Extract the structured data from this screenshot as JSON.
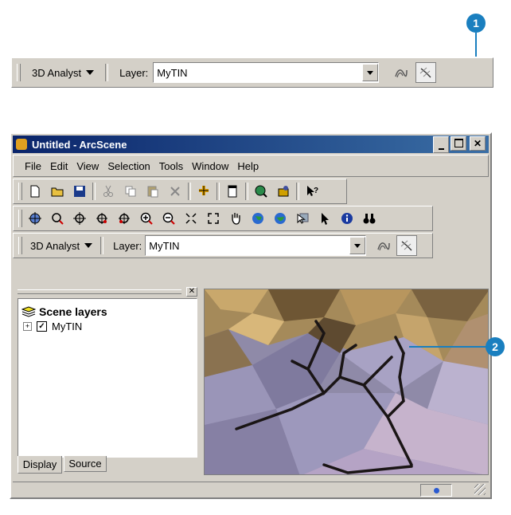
{
  "callouts": {
    "one": "1",
    "two": "2"
  },
  "top_toolbar": {
    "analyst_label": "3D Analyst",
    "layer_label": "Layer:",
    "layer_value": "MyTIN"
  },
  "window": {
    "title": "Untitled - ArcScene",
    "menu": [
      "File",
      "Edit",
      "View",
      "Selection",
      "Tools",
      "Window",
      "Help"
    ],
    "analyst_label": "3D Analyst",
    "layer_label": "Layer:",
    "layer_value": "MyTIN",
    "toc": {
      "header": "Scene layers",
      "layer_name": "MyTIN",
      "tab_display": "Display",
      "tab_source": "Source"
    }
  },
  "colors": {
    "title_bar": "#0a246a",
    "callout": "#1a7fbf",
    "chrome": "#d4d0c8"
  }
}
